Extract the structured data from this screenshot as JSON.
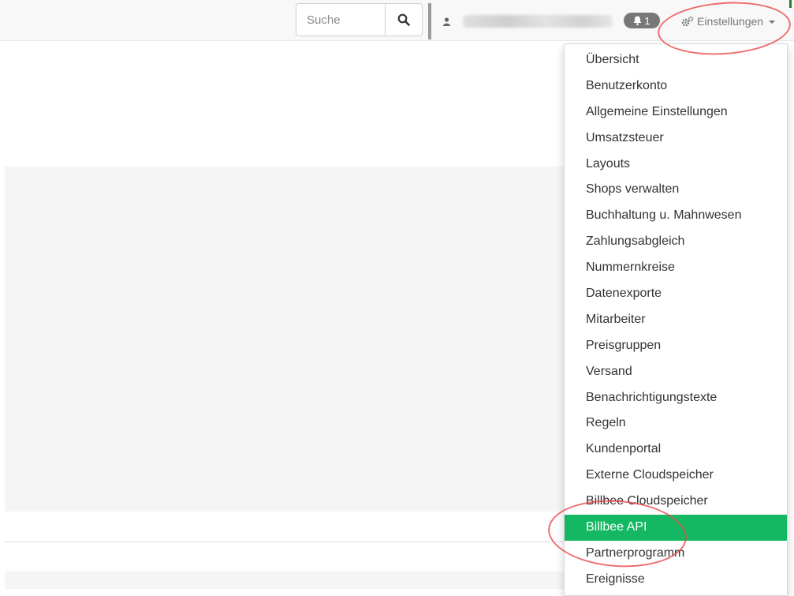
{
  "header": {
    "search": {
      "placeholder": "Suche",
      "value": ""
    },
    "user": {
      "icon": "user-icon"
    },
    "notifications": {
      "icon": "bell-icon",
      "count": "1"
    },
    "settings": {
      "label": "Einstellungen",
      "icon": "gears-icon"
    }
  },
  "settings_menu": {
    "active_item": "Billbee API",
    "active_color": "#14b863",
    "items": [
      "Übersicht",
      "Benutzerkonto",
      "Allgemeine Einstellungen",
      "Umsatzsteuer",
      "Layouts",
      "Shops verwalten",
      "Buchhaltung u. Mahnwesen",
      "Zahlungsabgleich",
      "Nummernkreise",
      "Datenexporte",
      "Mitarbeiter",
      "Preisgruppen",
      "Versand",
      "Benachrichtigungstexte",
      "Regeln",
      "Kundenportal",
      "Externe Cloudspeicher",
      "Billbee Cloudspeicher",
      "Billbee API",
      "Partnerprogramm",
      "Ereignisse"
    ]
  },
  "annotations": {
    "color": "#eb4646",
    "circled": [
      "Einstellungen",
      "Billbee API"
    ]
  }
}
